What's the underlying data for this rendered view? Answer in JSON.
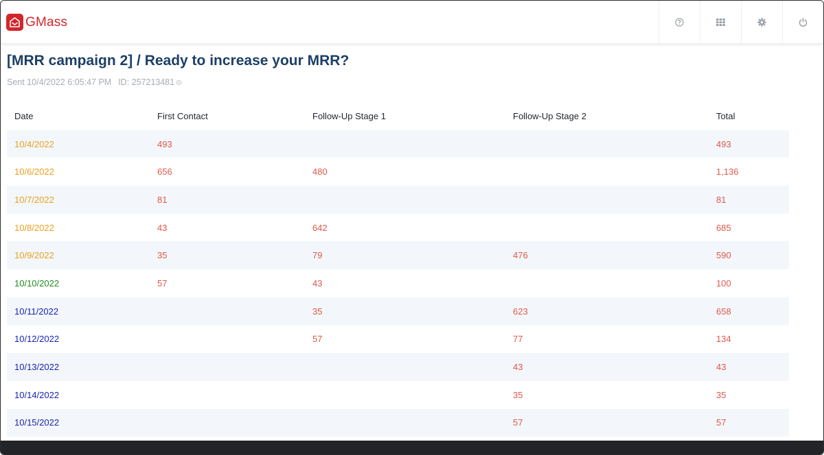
{
  "app": {
    "name": "GMass",
    "brand_color": "#d3262a"
  },
  "toolbar": {
    "icons": [
      "help-icon",
      "apps-grid-icon",
      "gear-icon",
      "power-icon"
    ]
  },
  "campaign": {
    "title": "[MRR campaign 2] / Ready to increase your MRR?",
    "sent": "Sent 10/4/2022 6:05:47 PM",
    "id": "ID: 257213481"
  },
  "table": {
    "headers": [
      "Date",
      "First Contact",
      "Follow-Up Stage 1",
      "Follow-Up Stage 2",
      "Total"
    ],
    "rows": [
      {
        "date": "10/4/2022",
        "date_color": "orange",
        "first": "493",
        "stage1": "",
        "stage2": "",
        "total": "493"
      },
      {
        "date": "10/6/2022",
        "date_color": "orange",
        "first": "656",
        "stage1": "480",
        "stage2": "",
        "total": "1,136"
      },
      {
        "date": "10/7/2022",
        "date_color": "orange",
        "first": "81",
        "stage1": "",
        "stage2": "",
        "total": "81"
      },
      {
        "date": "10/8/2022",
        "date_color": "orange",
        "first": "43",
        "stage1": "642",
        "stage2": "",
        "total": "685"
      },
      {
        "date": "10/9/2022",
        "date_color": "orange",
        "first": "35",
        "stage1": "79",
        "stage2": "476",
        "total": "590"
      },
      {
        "date": "10/10/2022",
        "date_color": "green",
        "first": "57",
        "stage1": "43",
        "stage2": "",
        "total": "100"
      },
      {
        "date": "10/11/2022",
        "date_color": "blue",
        "first": "",
        "stage1": "35",
        "stage2": "623",
        "total": "658"
      },
      {
        "date": "10/12/2022",
        "date_color": "blue",
        "first": "",
        "stage1": "57",
        "stage2": "77",
        "total": "134"
      },
      {
        "date": "10/13/2022",
        "date_color": "blue",
        "first": "",
        "stage1": "",
        "stage2": "43",
        "total": "43"
      },
      {
        "date": "10/14/2022",
        "date_color": "blue",
        "first": "",
        "stage1": "",
        "stage2": "35",
        "total": "35"
      },
      {
        "date": "10/15/2022",
        "date_color": "blue",
        "first": "",
        "stage1": "",
        "stage2": "57",
        "total": "57"
      }
    ]
  },
  "colors": {
    "title": "#1d3f66",
    "value": "#e0584c",
    "date_orange": "#eaa01e",
    "date_green": "#1e8a1e",
    "date_blue": "#1a22b0",
    "stripe": "#f3f7fb"
  }
}
